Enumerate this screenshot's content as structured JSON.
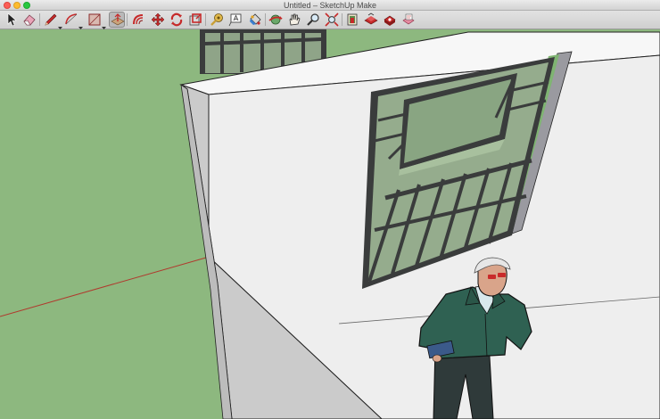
{
  "window": {
    "title": "Untitled – SketchUp Make"
  },
  "toolbar": {
    "tools": [
      {
        "name": "select-tool-button",
        "icon": "arrow-cursor-icon",
        "active": false
      },
      {
        "name": "eraser-tool-button",
        "icon": "eraser-icon",
        "active": false
      },
      {
        "name": "line-tool-button",
        "icon": "pencil-icon",
        "active": false,
        "dropdown": true
      },
      {
        "name": "arc-tool-button",
        "icon": "arc-icon",
        "active": false,
        "dropdown": true
      },
      {
        "name": "shape-tool-button",
        "icon": "rectangle-icon",
        "active": false,
        "dropdown": true
      },
      {
        "name": "push-pull-tool-button",
        "icon": "push-pull-icon",
        "active": true
      },
      {
        "name": "offset-tool-button",
        "icon": "offset-icon",
        "active": false
      },
      {
        "name": "move-tool-button",
        "icon": "move-icon",
        "active": false
      },
      {
        "name": "rotate-tool-button",
        "icon": "rotate-icon",
        "active": false
      },
      {
        "name": "scale-tool-button",
        "icon": "scale-icon",
        "active": false
      },
      {
        "name": "tape-measure-tool-button",
        "icon": "tape-measure-icon",
        "active": false
      },
      {
        "name": "text-tool-button",
        "icon": "text-icon",
        "active": false
      },
      {
        "name": "paint-bucket-tool-button",
        "icon": "paint-bucket-icon",
        "active": false
      },
      {
        "name": "orbit-tool-button",
        "icon": "orbit-icon",
        "active": false
      },
      {
        "name": "pan-tool-button",
        "icon": "pan-hand-icon",
        "active": false
      },
      {
        "name": "zoom-tool-button",
        "icon": "magnifier-icon",
        "active": false
      },
      {
        "name": "zoom-extents-tool-button",
        "icon": "zoom-extents-icon",
        "active": false
      },
      {
        "name": "warehouse-button",
        "icon": "3d-warehouse-icon",
        "active": false
      },
      {
        "name": "share-model-button",
        "icon": "share-model-icon",
        "active": false
      },
      {
        "name": "extension-warehouse-button",
        "icon": "extension-warehouse-icon",
        "active": false
      },
      {
        "name": "layout-button",
        "icon": "layout-icon",
        "active": false
      }
    ]
  },
  "colors": {
    "ground": "#8db87f",
    "wall_top": "#f6f6f6",
    "wall_front": "#ececec",
    "wall_side": "#c9c9c9",
    "window_frame": "#3a3c3c",
    "glass": "#96ad8e",
    "red_axis": "#b03a2e",
    "jacket": "#2f6152",
    "trousers": "#2f3a3a"
  }
}
